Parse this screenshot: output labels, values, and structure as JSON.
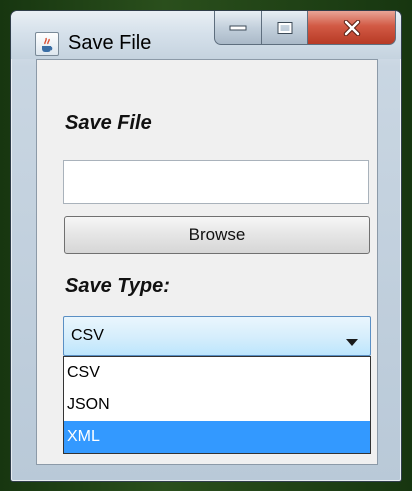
{
  "window": {
    "title": "Save File",
    "icon": "java-cup-icon",
    "caption_buttons": [
      "minimize-icon",
      "maximize-icon",
      "close-icon"
    ]
  },
  "form": {
    "save_file_label": "Save File",
    "file_path_value": "",
    "browse_label": "Browse",
    "save_type_label": "Save Type:"
  },
  "save_type": {
    "selected_value": "CSV",
    "options": [
      {
        "label": "CSV"
      },
      {
        "label": "JSON"
      },
      {
        "label": "XML"
      }
    ],
    "highlighted_option": "XML"
  },
  "colors": {
    "selection_highlight": "#3399ff",
    "close_button": "#c8503a",
    "combo_focus_border": "#5a8fc4"
  }
}
